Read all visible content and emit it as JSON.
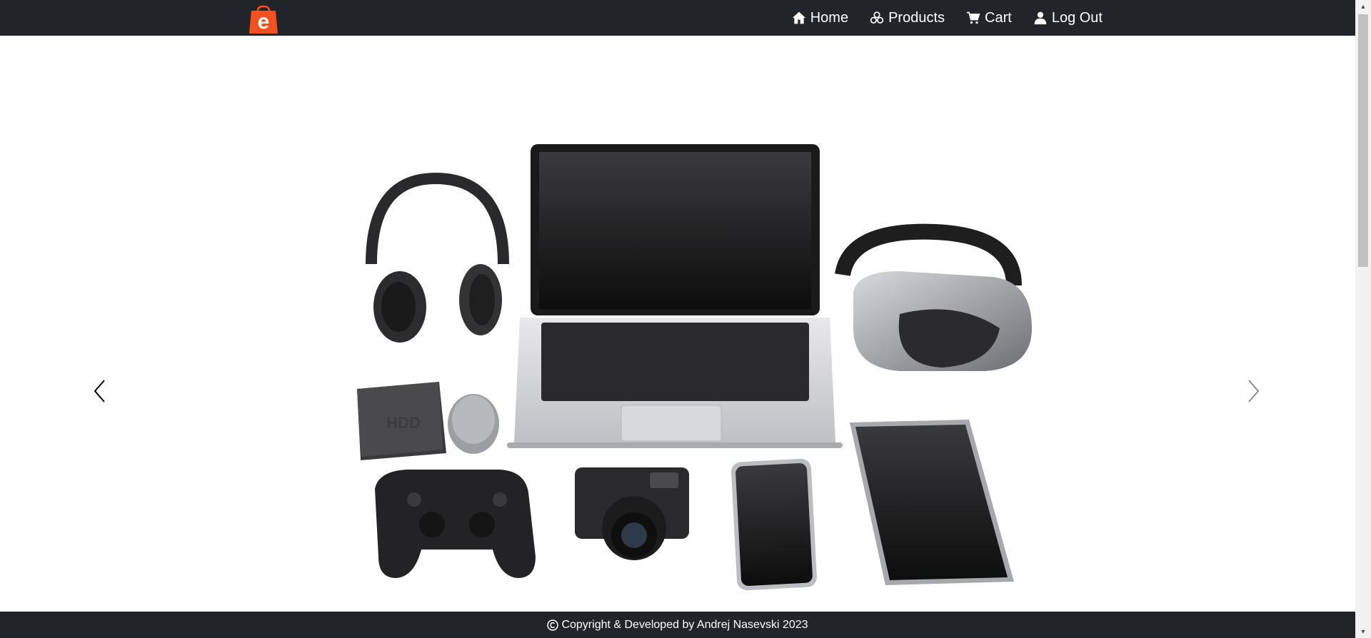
{
  "nav": {
    "logo_letter": "e",
    "items": [
      {
        "label": "Home",
        "icon": "home-icon"
      },
      {
        "label": "Products",
        "icon": "products-icon"
      },
      {
        "label": "Cart",
        "icon": "cart-icon"
      },
      {
        "label": "Log Out",
        "icon": "user-icon"
      }
    ]
  },
  "footer": {
    "text": "Copyright & Developed by Andrej Nasevski 2023"
  },
  "colors": {
    "navbar_bg": "#212529",
    "logo_orange": "#f4511e",
    "page_bg": "#ffffff"
  },
  "scrollbar": {
    "position_fraction": 0.0,
    "visible_fraction": 0.42
  }
}
